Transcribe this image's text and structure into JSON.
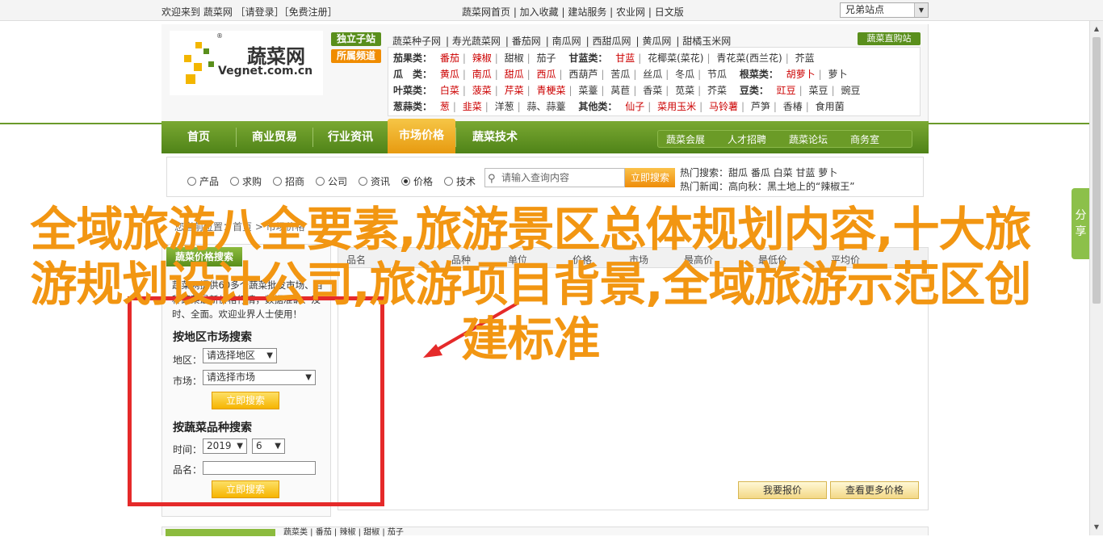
{
  "topbar": {
    "welcome": "欢迎来到 蔬菜网 ［请登录］［免费注册］",
    "links": "蔬菜网首页 | 加入收藏 | 建站服务 | 农业网 | 日文版",
    "site_select": "兄弟站点"
  },
  "logo": {
    "cn": "蔬菜网",
    "en": "Vegnet.com.cn",
    "reg": "®"
  },
  "tags": {
    "exclusive": "独立子站",
    "affiliate": "所属频道"
  },
  "top_links": [
    "蔬菜种子网",
    "寿光蔬菜网",
    "番茄网",
    "南瓜网",
    "西甜瓜网",
    "黄瓜网",
    "甜橘玉米网"
  ],
  "direct_station": "蔬菜直购站",
  "categories": [
    {
      "head": "茄果类：",
      "items": [
        "番茄",
        "辣椒",
        "甜椒",
        "茄子"
      ],
      "head2": "甘蓝类：",
      "items2": [
        "甘蓝",
        "花椰菜(菜花)",
        "青花菜(西兰花)",
        "芥蓝"
      ]
    },
    {
      "head": "瓜　类：",
      "items": [
        "黄瓜",
        "南瓜",
        "甜瓜",
        "西瓜",
        "西葫芦",
        "苦瓜",
        "丝瓜",
        "冬瓜",
        "节瓜"
      ],
      "head2": "根菜类：",
      "items2": [
        "胡萝卜",
        "萝卜"
      ]
    },
    {
      "head": "叶菜类：",
      "items": [
        "白菜",
        "菠菜",
        "芹菜",
        "青梗菜",
        "菜薹",
        "莴苣",
        "香菜",
        "苋菜",
        "芥菜"
      ],
      "head2": "豆类：",
      "items2": [
        "豇豆",
        "菜豆",
        "豌豆"
      ]
    },
    {
      "head": "葱蒜类：",
      "items": [
        "葱",
        "韭菜",
        "洋葱",
        "蒜、蒜薹"
      ],
      "head2": "其他类：",
      "items2": [
        "仙子",
        "菜用玉米",
        "马铃薯",
        "芦笋",
        "香椿",
        "食用菌"
      ]
    }
  ],
  "nav": {
    "items": [
      "首页",
      "商业贸易",
      "行业资讯",
      "市场价格",
      "蔬菜技术"
    ],
    "active": "市场价格",
    "sub": [
      "蔬菜会展",
      "人才招聘",
      "蔬菜论坛",
      "商务室"
    ]
  },
  "search": {
    "radios": [
      "产品",
      "求购",
      "招商",
      "公司",
      "资讯",
      "价格",
      "技术"
    ],
    "selected": "价格",
    "placeholder": "请输入查询内容",
    "button": "立即搜索",
    "hot_label": "热门搜索：",
    "hot_items": "甜瓜  番瓜  白菜  甘蓝  萝卜",
    "news_label": "热门新闻：",
    "news_text": "高向秋：黑土地上的“辣椒王”"
  },
  "breadcrumb": "您当前位置：首页 > 市场价格",
  "left_panel": {
    "tab": "蔬菜价格搜索",
    "desc": "蔬菜网提供60多个蔬菜批发市场、百种蔬菜最新价格行情，数据准确、及时、全面。欢迎业界人士使用！",
    "region_title": "按地区市场搜索",
    "region_label": "地区：",
    "region_value": "请选择地区",
    "market_label": "市场：",
    "market_value": "请选择市场",
    "search_btn": "立即搜索",
    "variety_title": "按蔬菜品种搜索",
    "time_label": "时间：",
    "year": "2019",
    "month": "6",
    "name_label": "品名：",
    "search_btn2": "立即搜索"
  },
  "right": {
    "cols": [
      "品名",
      "品种",
      "单位",
      "价格",
      "市场",
      "最高价",
      "最低价",
      "平均价"
    ],
    "btn_report": "我要报价",
    "btn_more": "查看更多价格"
  },
  "bottom": {
    "text": "蔬菜类 | 番茄 | 辣椒 | 甜椒 | 茄子"
  },
  "share": "分享",
  "overlay_title": "全域旅游八全要素,旅游景区总体规划内容,十大旅游规划设计公司,旅游项目背景,全域旅游示范区创建标准",
  "colors": {
    "accent_green": "#5a8f1c",
    "accent_orange": "#f29612",
    "highlight_red": "#e52a2a"
  }
}
